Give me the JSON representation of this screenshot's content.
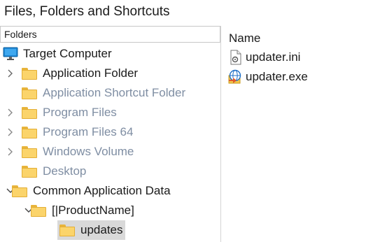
{
  "window": {
    "title": "Files, Folders and Shortcuts"
  },
  "tree": {
    "header": "Folders",
    "root": {
      "label": "Target Computer",
      "icon": "monitor-icon"
    },
    "items": [
      {
        "label": "Application Folder",
        "expandable": true,
        "dim": false
      },
      {
        "label": "Application Shortcut Folder",
        "expandable": false,
        "dim": true
      },
      {
        "label": "Program Files",
        "expandable": true,
        "dim": true
      },
      {
        "label": "Program Files 64",
        "expandable": true,
        "dim": true
      },
      {
        "label": "Windows Volume",
        "expandable": true,
        "dim": true
      },
      {
        "label": "Desktop",
        "expandable": false,
        "dim": true
      },
      {
        "label": "Common Application Data",
        "expandable": true,
        "expanded": true,
        "dim": false
      },
      {
        "label": "[|ProductName]",
        "expandable": true,
        "expanded": true,
        "dim": false
      },
      {
        "label": "updates",
        "expandable": false,
        "dim": false,
        "selected": true
      }
    ]
  },
  "files": {
    "column_name": "Name",
    "items": [
      {
        "name": "updater.ini",
        "icon": "ini-file-icon"
      },
      {
        "name": "updater.exe",
        "icon": "exe-file-icon"
      }
    ]
  },
  "colors": {
    "folder": "#fbd46b",
    "dim_text": "#7f8ea3",
    "selection": "#d9d9d9"
  }
}
